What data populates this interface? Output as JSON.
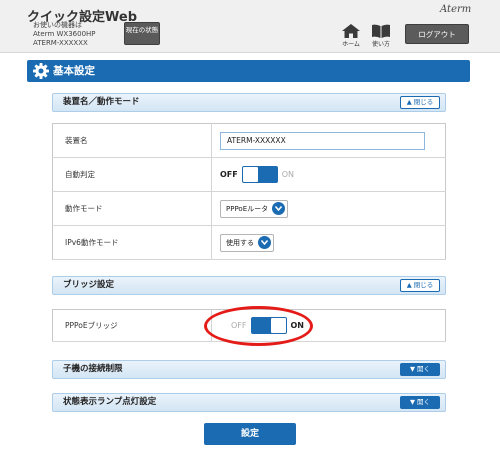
{
  "header": {
    "app_title": "クイック設定Web",
    "device_label": "お使いの機器は",
    "device_model": "Aterm WX3600HP",
    "device_name": "ATERM-XXXXXX",
    "status_button": "現在の状態",
    "brand": "Aterm",
    "home_label": "ホーム",
    "help_label": "使い方",
    "logout_label": "ログアウト"
  },
  "section": {
    "title": "基本設定",
    "icon": "gear-icon"
  },
  "device_panel": {
    "title": "装置名／動作モード",
    "toggle_label": "閉じる",
    "rows": {
      "device_name": {
        "label": "装置名",
        "value": "ATERM-XXXXXX"
      },
      "auto_detect": {
        "label": "自動判定",
        "off": "OFF",
        "on": "ON",
        "state": "OFF"
      },
      "op_mode": {
        "label": "動作モード",
        "value": "PPPoEルータ"
      },
      "ipv6_mode": {
        "label": "IPv6動作モード",
        "value": "使用する"
      }
    }
  },
  "bridge_panel": {
    "title": "ブリッジ設定",
    "toggle_label": "閉じる",
    "rows": {
      "pppoe_bridge": {
        "label": "PPPoEブリッジ",
        "off": "OFF",
        "on": "ON",
        "state": "ON"
      }
    }
  },
  "child_panel": {
    "title": "子機の接続制限",
    "toggle_label": "開く"
  },
  "lamp_panel": {
    "title": "状態表示ランプ点灯設定",
    "toggle_label": "開く"
  },
  "submit_label": "設定",
  "colors": {
    "primary": "#1b6bb3",
    "highlight": "#e41b17"
  }
}
